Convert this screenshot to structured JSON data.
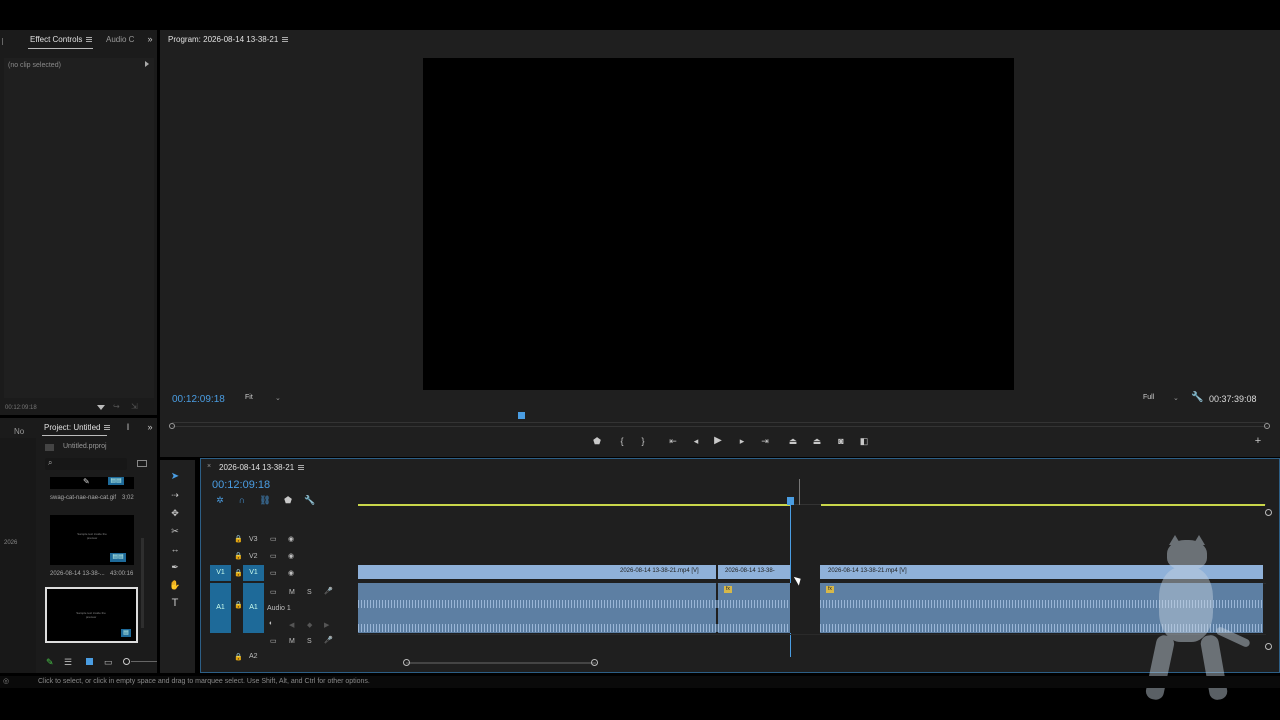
{
  "effect_controls": {
    "tab_label": "Effect Controls",
    "tab2_label": "Audio C",
    "no_clip": "(no clip selected)",
    "timecode": "00:12:09:18"
  },
  "program_monitor": {
    "title": "Program: 2026-08-14 13-38-21",
    "timecode_left": "00:12:09:18",
    "fit_label": "Fit",
    "quality_label": "Full",
    "duration": "00:37:39:08"
  },
  "project_panel": {
    "tab_left": "No",
    "tab_label": "Project: Untitled",
    "file_name": "Untitled.prproj",
    "item1_name": "swag-cat-nae-nae-cat.gif",
    "item1_duration": "3;02",
    "item2_name": "2026-08-14 13-38-...",
    "item2_duration": "43:00:16",
    "thumbnail_text": "Sample text inside the preview",
    "side_label": "2026"
  },
  "timeline": {
    "sequence_name": "2026-08-14 13-38-21",
    "timecode": "00:12:09:18",
    "tracks": {
      "v3": "V3",
      "v2": "V2",
      "v1": "V1",
      "v1_source": "V1",
      "a1": "A1",
      "a1_source": "A1",
      "a1_name": "Audio 1",
      "a2": "A2",
      "m": "M",
      "s": "S"
    },
    "clips": {
      "clip1_label": "2026-08-14 13-38-21.mp4 [V]",
      "clip2_label": "2026-08-14 13-38-",
      "clip3_label": "2026-08-14 13-38-21.mp4 [V]",
      "badge": "fx"
    }
  },
  "status_bar": {
    "text": "Click to select, or click in empty space and drag to marquee select. Use Shift, Alt, and Ctrl for other options."
  },
  "colors": {
    "accent": "#4a9de2",
    "clip_video": "#8fb1d9",
    "clip_audio": "#5d7fa3",
    "work_area": "#c9d64a"
  }
}
